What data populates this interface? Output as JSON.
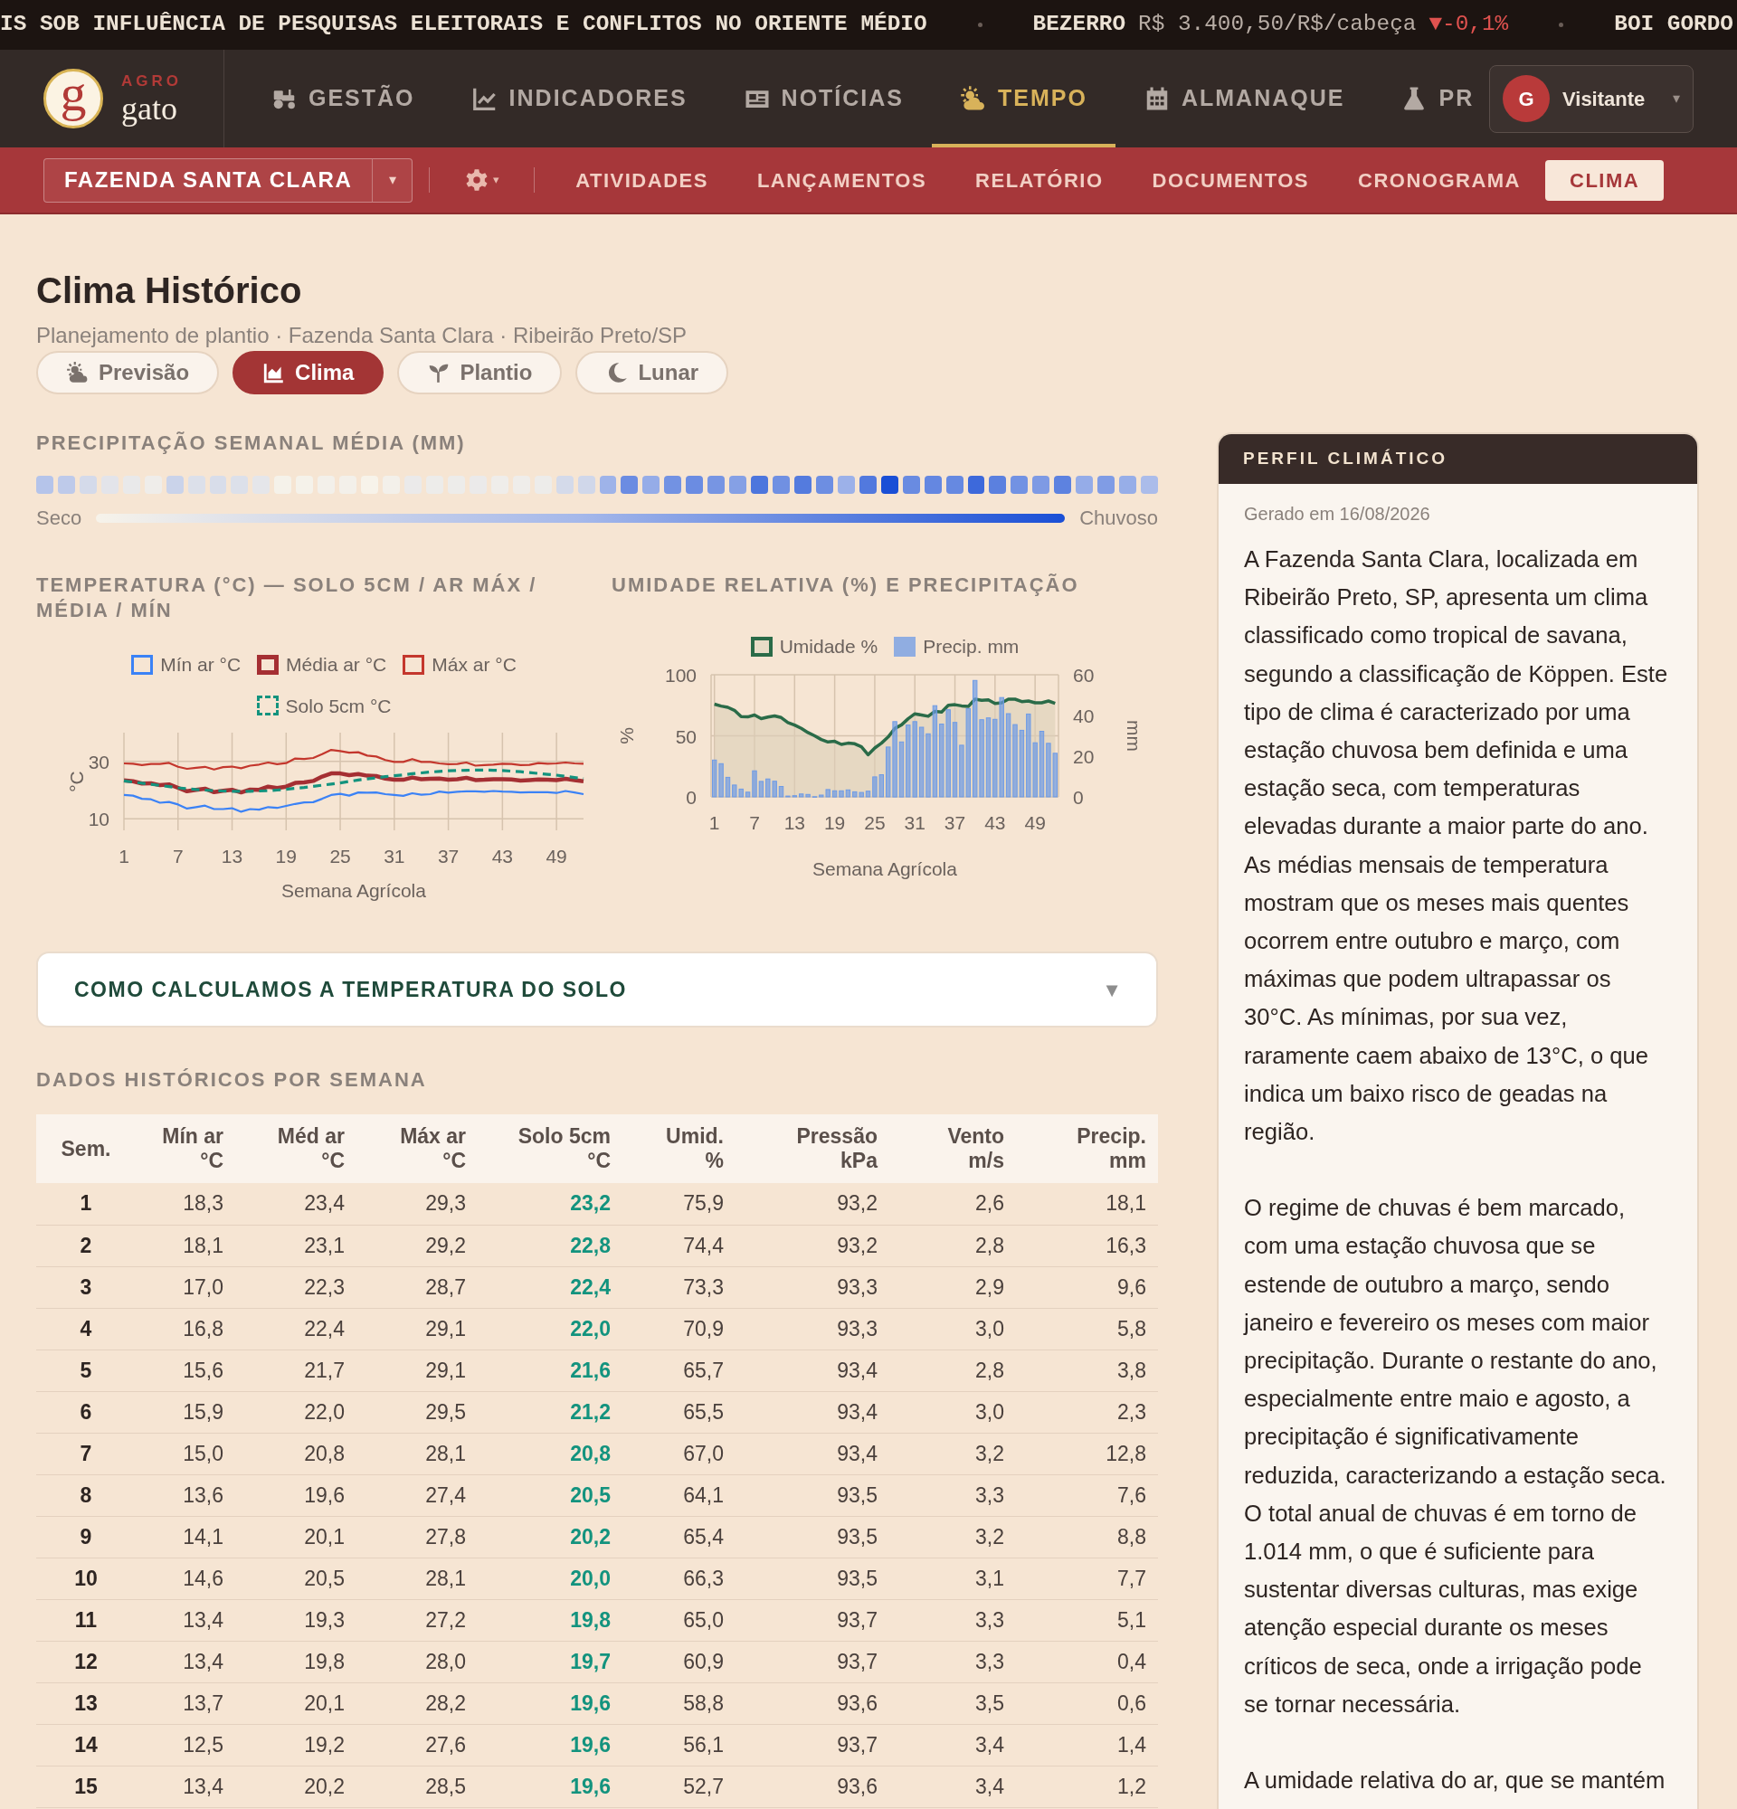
{
  "ticker": [
    {
      "kind": "headline",
      "text": "IS SOB INFLUÊNCIA DE PESQUISAS ELEITORAIS E CONFLITOS NO ORIENTE MÉDIO"
    },
    {
      "kind": "quote",
      "name": "BEZERRO",
      "value": "R$ 3.400,50/R$/cabeça",
      "change": "▼-0,1%"
    },
    {
      "kind": "quote",
      "name": "BOI GORDO"
    }
  ],
  "brand": {
    "mark": "g",
    "tag": "AGRO",
    "name": "gato"
  },
  "nav": [
    {
      "label": "GESTÃO",
      "selected": false
    },
    {
      "label": "INDICADORES",
      "selected": false
    },
    {
      "label": "NOTÍCIAS",
      "selected": false
    },
    {
      "label": "TEMPO",
      "selected": true
    },
    {
      "label": "ALMANAQUE",
      "selected": false
    },
    {
      "label": "PR",
      "selected": false
    }
  ],
  "user": {
    "initial": "G",
    "name": "Visitante",
    "caret": "▾"
  },
  "farm_select": {
    "value": "FAZENDA SANTA CLARA",
    "caret": "▾"
  },
  "settings": {
    "caret": "▾"
  },
  "subnav": [
    {
      "label": "ATIVIDADES",
      "selected": false
    },
    {
      "label": "LANÇAMENTOS",
      "selected": false
    },
    {
      "label": "RELATÓRIO",
      "selected": false
    },
    {
      "label": "DOCUMENTOS",
      "selected": false
    },
    {
      "label": "CRONOGRAMA",
      "selected": false
    },
    {
      "label": "CLIMA",
      "selected": true
    }
  ],
  "page": {
    "title": "Clima Histórico",
    "subtitle": "Planejamento de plantio · Fazenda Santa Clara · Ribeirão Preto/SP"
  },
  "view_tabs": [
    {
      "label": "Previsão",
      "selected": false
    },
    {
      "label": "Clima",
      "selected": true
    },
    {
      "label": "Plantio",
      "selected": false
    },
    {
      "label": "Lunar",
      "selected": false
    }
  ],
  "precip_strip": {
    "title": "PRECIPITAÇÃO SEMANAL MÉDIA (MM)",
    "low_label": "Seco",
    "high_label": "Chuvoso",
    "cells": [
      {
        "color": "#b5c4ea"
      },
      {
        "color": "#becaea"
      },
      {
        "color": "#d4daea"
      },
      {
        "color": "#e3e4ea"
      },
      {
        "color": "#e9e9ea"
      },
      {
        "color": "#efedea"
      },
      {
        "color": "#cad3ea"
      },
      {
        "color": "#dce0ea"
      },
      {
        "color": "#d8ddea"
      },
      {
        "color": "#dce0ea"
      },
      {
        "color": "#e5e6ea"
      },
      {
        "color": "#f5f2ea"
      },
      {
        "color": "#f5f2ea"
      },
      {
        "color": "#f3f0ea"
      },
      {
        "color": "#f3f0ea"
      },
      {
        "color": "#f7f3ea"
      },
      {
        "color": "#f3f0ea"
      },
      {
        "color": "#ebeaea"
      },
      {
        "color": "#edecea"
      },
      {
        "color": "#edecea"
      },
      {
        "color": "#ebeaea"
      },
      {
        "color": "#efedea"
      },
      {
        "color": "#efedea"
      },
      {
        "color": "#edecea"
      },
      {
        "color": "#d4daea"
      },
      {
        "color": "#d0d7ea"
      },
      {
        "color": "#9eb3e9"
      },
      {
        "color": "#6b8ce2"
      },
      {
        "color": "#95ace8"
      },
      {
        "color": "#7292e3"
      },
      {
        "color": "#6b8ce2"
      },
      {
        "color": "#7795e3"
      },
      {
        "color": "#85a0e5"
      },
      {
        "color": "#4d76dd"
      },
      {
        "color": "#7090e2"
      },
      {
        "color": "#547bde"
      },
      {
        "color": "#6d8ee2"
      },
      {
        "color": "#9cb1e9"
      },
      {
        "color": "#5279de"
      },
      {
        "color": "#1a4fd6"
      },
      {
        "color": "#698be1"
      },
      {
        "color": "#6487e1"
      },
      {
        "color": "#6689e1"
      },
      {
        "color": "#3d69db"
      },
      {
        "color": "#5b80df"
      },
      {
        "color": "#7292e3"
      },
      {
        "color": "#7e9ae4"
      },
      {
        "color": "#5d82e0"
      },
      {
        "color": "#95ace8"
      },
      {
        "color": "#809ce5"
      },
      {
        "color": "#97aee8"
      },
      {
        "color": "#abbcea"
      }
    ]
  },
  "temperature_chart": {
    "title": "TEMPERATURA (°C) — SOLO 5CM / AR MÁX / MÉDIA / MÍN",
    "chart_data": {
      "type": "line",
      "xlabel": "Semana Agrícola",
      "ylabel": "°C",
      "grid": true,
      "legend": "top",
      "x": [
        1,
        2,
        3,
        4,
        5,
        6,
        7,
        8,
        9,
        10,
        11,
        12,
        13,
        14,
        15,
        16,
        17,
        18,
        19,
        20,
        21,
        22,
        23,
        24,
        25,
        26,
        27,
        28,
        29,
        30,
        31,
        32,
        33,
        34,
        35,
        36,
        37,
        38,
        39,
        40,
        41,
        42,
        43,
        44,
        45,
        46,
        47,
        48,
        49,
        50,
        51,
        52
      ],
      "series": [
        {
          "name": "Mín ar °C",
          "color": "#3b82f6",
          "line_style": "solid",
          "values": [
            18.3,
            18.1,
            17.0,
            16.8,
            15.6,
            15.9,
            15.0,
            13.6,
            14.1,
            14.6,
            13.4,
            13.4,
            13.7,
            12.5,
            13.4,
            13.2,
            14.1,
            13.8,
            14.5,
            15.2,
            15.7,
            15.8,
            17.0,
            18.3,
            18.7,
            18.1,
            19.2,
            19.1,
            19.2,
            18.6,
            18.3,
            18.0,
            18.9,
            18.4,
            18.6,
            19.5,
            19.1,
            19.4,
            19.6,
            19.6,
            19.4,
            19.7,
            19.5,
            19.4,
            19.2,
            19.3,
            19.3,
            19.3,
            19.0,
            19.7,
            19.2,
            18.6
          ]
        },
        {
          "name": "Média ar °C",
          "color": "#a52f33",
          "line_style": "solid",
          "values": [
            23.4,
            23.1,
            22.3,
            22.4,
            21.7,
            22.0,
            20.8,
            19.6,
            20.1,
            20.5,
            19.3,
            19.8,
            20.1,
            19.2,
            20.2,
            20.1,
            21.2,
            20.7,
            21.2,
            22.5,
            22.7,
            23.2,
            24.7,
            25.8,
            25.8,
            25.2,
            25.6,
            25.0,
            24.9,
            24.0,
            23.6,
            23.6,
            24.4,
            23.8,
            23.9,
            24.0,
            23.6,
            23.8,
            24.3,
            23.5,
            23.6,
            23.8,
            23.8,
            23.7,
            23.3,
            23.5,
            23.7,
            23.6,
            23.5,
            23.9,
            23.5,
            23.1
          ]
        },
        {
          "name": "Máx ar °C",
          "color": "#c4372d",
          "line_style": "solid",
          "values": [
            29.3,
            29.2,
            28.7,
            29.1,
            29.1,
            29.5,
            28.1,
            27.4,
            27.8,
            28.1,
            27.2,
            28.0,
            28.2,
            27.6,
            28.5,
            28.9,
            29.6,
            29.0,
            29.4,
            31.0,
            30.8,
            31.2,
            32.5,
            34.0,
            33.6,
            33.0,
            33.2,
            32.0,
            31.7,
            30.5,
            29.8,
            29.8,
            30.8,
            29.8,
            29.8,
            29.3,
            29.0,
            29.1,
            29.6,
            28.5,
            28.7,
            28.9,
            29.2,
            29.1,
            28.7,
            28.8,
            29.4,
            29.2,
            29.3,
            29.6,
            29.3,
            29.2
          ]
        },
        {
          "name": "Solo 5cm °C",
          "color": "#13937e",
          "line_style": "dashed",
          "values": [
            23.2,
            22.8,
            22.4,
            22.0,
            21.6,
            21.2,
            20.8,
            20.5,
            20.2,
            20.0,
            19.8,
            19.7,
            19.6,
            19.6,
            19.6,
            19.7,
            19.8,
            20.0,
            20.3,
            20.6,
            20.9,
            21.3,
            21.7,
            22.1,
            22.5,
            23.0,
            23.5,
            23.9,
            24.3,
            24.7,
            25.0,
            25.3,
            25.7,
            26.0,
            26.3,
            26.5,
            26.7,
            26.8,
            26.9,
            27.0,
            27.0,
            26.9,
            26.8,
            26.6,
            26.4,
            26.1,
            25.8,
            25.5,
            25.2,
            24.8,
            24.4,
            24.0
          ]
        }
      ],
      "xlim": [
        1,
        52
      ],
      "ylim": [
        6,
        40
      ],
      "xticks": [
        1,
        7,
        13,
        19,
        25,
        31,
        37,
        43,
        49
      ],
      "yticks": [
        10,
        30
      ]
    }
  },
  "humidity_chart": {
    "title": "UMIDADE RELATIVA (%) E PRECIPITAÇÃO",
    "chart_data": {
      "type": "bar",
      "xlabel": "Semana Agrícola",
      "ylabel": "%",
      "y2label": "mm",
      "grid": true,
      "legend": "top",
      "x": [
        1,
        2,
        3,
        4,
        5,
        6,
        7,
        8,
        9,
        10,
        11,
        12,
        13,
        14,
        15,
        16,
        17,
        18,
        19,
        20,
        21,
        22,
        23,
        24,
        25,
        26,
        27,
        28,
        29,
        30,
        31,
        32,
        33,
        34,
        35,
        36,
        37,
        38,
        39,
        40,
        41,
        42,
        43,
        44,
        45,
        46,
        47,
        48,
        49,
        50,
        51,
        52
      ],
      "series": [
        {
          "name": "Umidade %",
          "color": "#2a6b48",
          "type": "area",
          "values": [
            75.9,
            74.4,
            73.3,
            70.9,
            65.7,
            65.5,
            67.0,
            64.1,
            65.4,
            66.3,
            65.0,
            60.9,
            58.8,
            56.1,
            52.7,
            50,
            47,
            45,
            45.5,
            43,
            44,
            43.5,
            41,
            34.5,
            40,
            44,
            49,
            56,
            59,
            64,
            68,
            67,
            66,
            70,
            69.5,
            75,
            75.5,
            74.5,
            74,
            80,
            79,
            79.5,
            76.5,
            77,
            80,
            80,
            78,
            78.5,
            77,
            77,
            78.5,
            76.5
          ]
        },
        {
          "name": "Precip. mm",
          "color": "#6e9be6",
          "axis": "y2",
          "values": [
            18.1,
            16.3,
            9.6,
            5.8,
            3.8,
            2.3,
            12.8,
            7.6,
            8.8,
            7.7,
            5.1,
            0.4,
            0.6,
            1.4,
            1.2,
            0.1,
            0.9,
            3.6,
            3.0,
            3.0,
            3.4,
            2.5,
            2.2,
            2.8,
            9.8,
            10.9,
            24.5,
            37.0,
            27.0,
            35.3,
            37.0,
            34.2,
            31.0,
            44.8,
            35.8,
            42.8,
            36.6,
            25.4,
            43.4,
            57.2,
            37.9,
            38.8,
            38.1,
            48.8,
            40.9,
            35.5,
            32.7,
            40.7,
            26.6,
            32.2,
            26.3,
            21.4
          ]
        }
      ],
      "xlim": [
        0.5,
        52.5
      ],
      "ylim": [
        0,
        100
      ],
      "y2lim": [
        0,
        60
      ],
      "xticks": [
        1,
        7,
        13,
        19,
        25,
        31,
        37,
        43,
        49
      ],
      "yticks": [
        0,
        50,
        100
      ],
      "y2ticks": [
        0,
        20,
        40,
        60
      ]
    }
  },
  "accordion": {
    "title": "COMO CALCULAMOS A TEMPERATURA DO SOLO",
    "icon": "▼",
    "expanded": false
  },
  "table": {
    "title": "DADOS HISTÓRICOS POR SEMANA",
    "columns": [
      {
        "label": "Sem.",
        "kind": "index"
      },
      {
        "label": "Mín ar",
        "unit": "°C",
        "kind": "value"
      },
      {
        "label": "Méd ar",
        "unit": "°C",
        "kind": "value"
      },
      {
        "label": "Máx ar",
        "unit": "°C",
        "kind": "value"
      },
      {
        "label": "Solo 5cm",
        "unit": "°C",
        "kind": "soil"
      },
      {
        "label": "Umid.",
        "unit": "%",
        "kind": "value"
      },
      {
        "label": "Pressão",
        "unit": "kPa",
        "kind": "value"
      },
      {
        "label": "Vento",
        "unit": "m/s",
        "kind": "value"
      },
      {
        "label": "Precip.",
        "unit": "mm",
        "kind": "value"
      }
    ],
    "rows": [
      [
        "1",
        "18,3",
        "23,4",
        "29,3",
        "23,2",
        "75,9",
        "93,2",
        "2,6",
        "18,1"
      ],
      [
        "2",
        "18,1",
        "23,1",
        "29,2",
        "22,8",
        "74,4",
        "93,2",
        "2,8",
        "16,3"
      ],
      [
        "3",
        "17,0",
        "22,3",
        "28,7",
        "22,4",
        "73,3",
        "93,3",
        "2,9",
        "9,6"
      ],
      [
        "4",
        "16,8",
        "22,4",
        "29,1",
        "22,0",
        "70,9",
        "93,3",
        "3,0",
        "5,8"
      ],
      [
        "5",
        "15,6",
        "21,7",
        "29,1",
        "21,6",
        "65,7",
        "93,4",
        "2,8",
        "3,8"
      ],
      [
        "6",
        "15,9",
        "22,0",
        "29,5",
        "21,2",
        "65,5",
        "93,4",
        "3,0",
        "2,3"
      ],
      [
        "7",
        "15,0",
        "20,8",
        "28,1",
        "20,8",
        "67,0",
        "93,4",
        "3,2",
        "12,8"
      ],
      [
        "8",
        "13,6",
        "19,6",
        "27,4",
        "20,5",
        "64,1",
        "93,5",
        "3,3",
        "7,6"
      ],
      [
        "9",
        "14,1",
        "20,1",
        "27,8",
        "20,2",
        "65,4",
        "93,5",
        "3,2",
        "8,8"
      ],
      [
        "10",
        "14,6",
        "20,5",
        "28,1",
        "20,0",
        "66,3",
        "93,5",
        "3,1",
        "7,7"
      ],
      [
        "11",
        "13,4",
        "19,3",
        "27,2",
        "19,8",
        "65,0",
        "93,7",
        "3,3",
        "5,1"
      ],
      [
        "12",
        "13,4",
        "19,8",
        "28,0",
        "19,7",
        "60,9",
        "93,7",
        "3,3",
        "0,4"
      ],
      [
        "13",
        "13,7",
        "20,1",
        "28,2",
        "19,6",
        "58,8",
        "93,6",
        "3,5",
        "0,6"
      ],
      [
        "14",
        "12,5",
        "19,2",
        "27,6",
        "19,6",
        "56,1",
        "93,7",
        "3,4",
        "1,4"
      ],
      [
        "15",
        "13,4",
        "20,2",
        "28,5",
        "19,6",
        "52,7",
        "93,6",
        "3,4",
        "1,2"
      ]
    ]
  },
  "sidebar": {
    "title": "PERFIL CLIMÁTICO",
    "generated": "Gerado em 16/08/2026",
    "paragraphs": [
      "A Fazenda Santa Clara, localizada em Ribeirão Preto, SP, apresenta um clima classificado como tropical de savana, segundo a classificação de Köppen. Este tipo de clima é caracterizado por uma estação chuvosa bem definida e uma estação seca, com temperaturas elevadas durante a maior parte do ano. As médias mensais de temperatura mostram que os meses mais quentes ocorrem entre outubro e março, com máximas que podem ultrapassar os 30°C. As mínimas, por sua vez, raramente caem abaixo de 13°C, o que indica um baixo risco de geadas na região.",
      "O regime de chuvas é bem marcado, com uma estação chuvosa que se estende de outubro a março, sendo janeiro e fevereiro os meses com maior precipitação. Durante o restante do ano, especialmente entre maio e agosto, a precipitação é significativamente reduzida, caracterizando a estação seca. O total anual de chuvas é em torno de 1.014 mm, o que é suficiente para sustentar diversas culturas, mas exige atenção especial durante os meses críticos de seca, onde a irrigação pode se tornar necessária.",
      "A umidade relativa do ar, que se mantém"
    ]
  }
}
